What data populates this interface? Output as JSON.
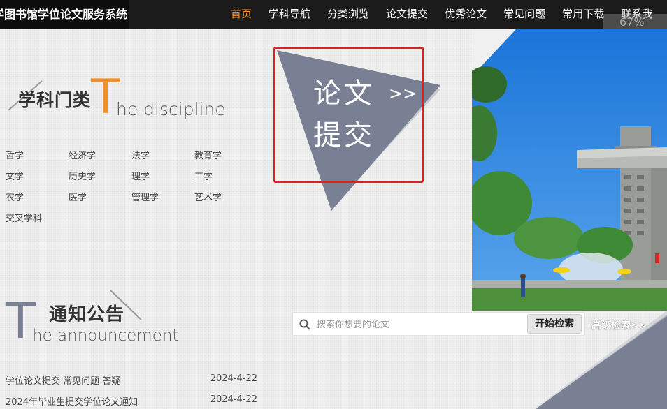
{
  "site_title": "学图书馆学位论文服务系统",
  "nav": [
    {
      "label": "首页",
      "active": true
    },
    {
      "label": "学科导航"
    },
    {
      "label": "分类浏览"
    },
    {
      "label": "论文提交"
    },
    {
      "label": "优秀论文"
    },
    {
      "label": "常见问题"
    },
    {
      "label": "常用下载"
    },
    {
      "label": "联系我"
    }
  ],
  "zoom_level": "67%",
  "discipline": {
    "heading_cn": "学科门类",
    "heading_en_big": "T",
    "heading_en_rest": "he discipline",
    "items": [
      "哲学",
      "经济学",
      "法学",
      "教育学",
      "文学",
      "历史学",
      "理学",
      "工学",
      "农学",
      "医学",
      "管理学",
      "艺术学",
      "交叉学科"
    ]
  },
  "submit": {
    "line1": "论文",
    "line2": "提交",
    "arrows": ">>"
  },
  "search": {
    "placeholder": "搜索你想要的论文",
    "button_label": "开始检索",
    "advanced_label": "高级检索>>"
  },
  "announcement": {
    "heading_cn": "通知公告",
    "heading_en_big": "T",
    "heading_en_rest": "he announcement",
    "items": [
      {
        "title": "学位论文提交 常见问题 答疑",
        "date": "2024-4-22"
      },
      {
        "title": "2024年毕业生提交学位论文通知",
        "date": "2024-4-22"
      }
    ]
  },
  "colors": {
    "accent_orange": "#f0902a",
    "triangle_slate": "#7a8094",
    "highlight_red": "#e02020"
  }
}
